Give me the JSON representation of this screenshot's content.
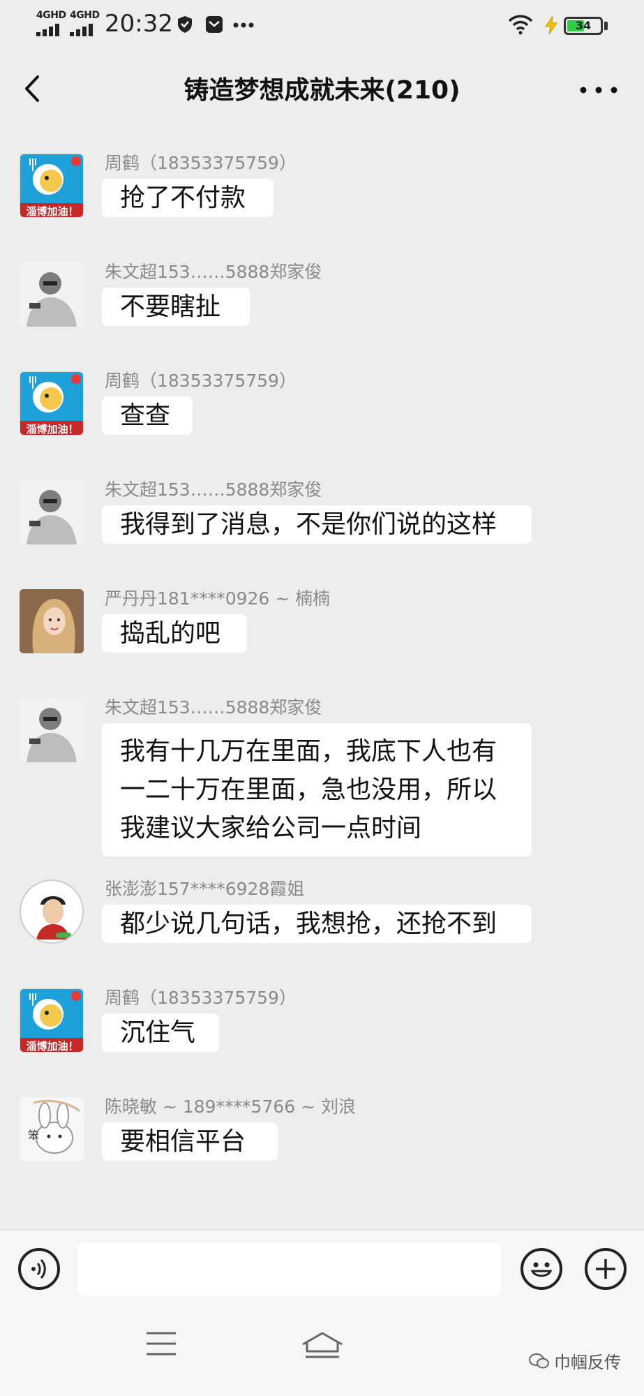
{
  "status_bar": {
    "signal1_label": "4GHD",
    "signal2_label": "4GHD",
    "time": "20:32",
    "battery": "34",
    "icons": [
      "shield-icon",
      "message-icon",
      "more-dots-icon",
      "wifi-icon",
      "charging-icon",
      "battery-icon"
    ]
  },
  "header": {
    "title": "铸造梦想成就未来(210)",
    "back_icon": "chevron-left-icon",
    "more_icon": "more-dots-icon"
  },
  "messages": [
    {
      "sender": "周鹤（18353375759）",
      "avatar": "zibo",
      "lines": [
        "抢了不付款"
      ]
    },
    {
      "sender": "朱文超153……5888郑家俊",
      "avatar": "zhu",
      "lines": [
        "不要瞎扯"
      ]
    },
    {
      "sender": "周鹤（18353375759）",
      "avatar": "zibo",
      "lines": [
        "查查"
      ]
    },
    {
      "sender": "朱文超153……5888郑家俊",
      "avatar": "zhu",
      "lines": [
        "我得到了消息，不是你们说的这样"
      ]
    },
    {
      "sender": "严丹丹181****0926 ~ 楠楠",
      "avatar": "yan",
      "lines": [
        "捣乱的吧"
      ]
    },
    {
      "sender": "朱文超153……5888郑家俊",
      "avatar": "zhu",
      "lines": [
        "我有十几万在里面，我底下人也有",
        "一二十万在里面，急也没用，所以",
        "我建议大家给公司一点时间"
      ]
    },
    {
      "sender": "张澎澎157****6928霞姐",
      "avatar": "zhang",
      "lines": [
        "都少说几句话，我想抢，还抢不到"
      ]
    },
    {
      "sender": "周鹤（18353375759）",
      "avatar": "zibo",
      "lines": [
        "沉住气"
      ]
    },
    {
      "sender": "陈晓敏 ~ 189****5766 ~ 刘浪",
      "avatar": "chen",
      "lines": [
        "要相信平台"
      ]
    }
  ],
  "avatar_text": {
    "zibo": "淄博加油！",
    "chen": "笨"
  },
  "input_bar": {
    "voice_icon": "voice-icon",
    "emoji_icon": "emoji-icon",
    "plus_icon": "plus-icon",
    "text_value": ""
  },
  "nav_bar": {
    "menu_icon": "menu-icon",
    "home_icon": "home-icon"
  },
  "watermark": {
    "icon": "wechat-icon",
    "text": "巾帼反传"
  }
}
